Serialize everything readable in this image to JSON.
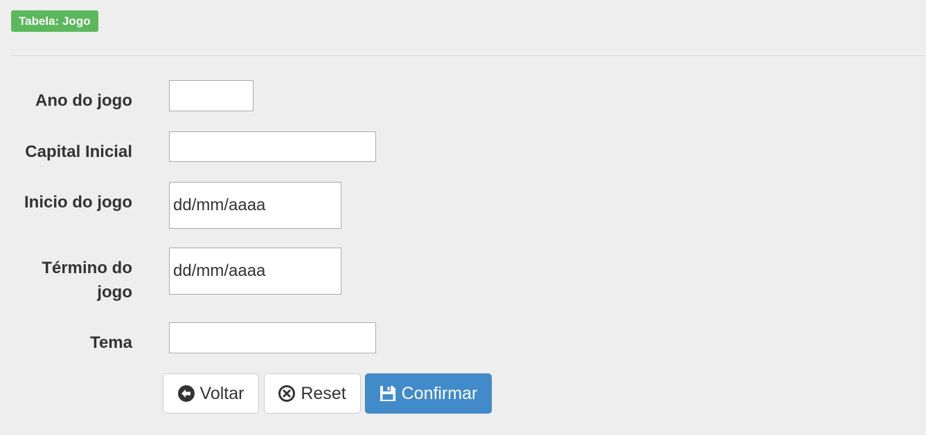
{
  "header": {
    "badge_text": "Tabela: Jogo"
  },
  "form": {
    "fields": [
      {
        "label": "Ano do jogo",
        "value": "",
        "placeholder": ""
      },
      {
        "label": "Capital Inicial",
        "value": "",
        "placeholder": ""
      },
      {
        "label": "Inicio do jogo",
        "value": "dd/mm/aaaa",
        "placeholder": "dd/mm/aaaa"
      },
      {
        "label": "Término do jogo",
        "value": "dd/mm/aaaa",
        "placeholder": "dd/mm/aaaa"
      },
      {
        "label": "Tema",
        "value": "",
        "placeholder": ""
      }
    ]
  },
  "actions": {
    "back": {
      "label": "Voltar",
      "icon": "arrow-circle-left-icon"
    },
    "reset": {
      "label": "Reset",
      "icon": "times-circle-icon"
    },
    "confirm": {
      "label": "Confirmar",
      "icon": "floppy-disk-icon"
    }
  },
  "colors": {
    "badge": "#5cb85c",
    "primary": "#428bca",
    "background": "#eeeeee"
  }
}
